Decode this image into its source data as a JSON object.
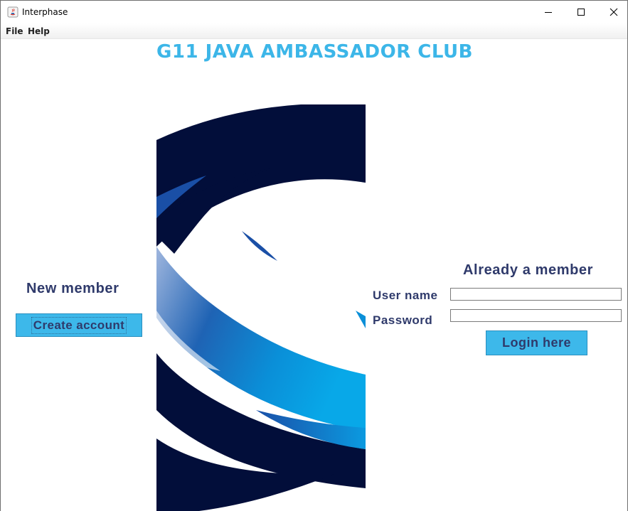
{
  "window": {
    "title": "Interphase",
    "controls": [
      "minimize-icon",
      "maximize-icon",
      "close-icon"
    ]
  },
  "menu": {
    "items": [
      {
        "label": "File"
      },
      {
        "label": "Help"
      }
    ]
  },
  "header": {
    "title": "G11 JAVA AMBASSADOR CLUB"
  },
  "new_member": {
    "heading": "New member",
    "button_label": "Create account"
  },
  "login": {
    "heading": "Already a member",
    "username_label": "User name",
    "password_label": "Password",
    "username_value": "",
    "password_value": "",
    "button_label": "Login here"
  },
  "colors": {
    "title": "#3cb6e8",
    "text": "#2f3a6b",
    "button": "#3db8ea",
    "logo_dark": "#020e3a",
    "logo_blue": "#0a8fd8"
  },
  "icons": {
    "app": "java-icon",
    "logo": "swoosh-logo"
  }
}
